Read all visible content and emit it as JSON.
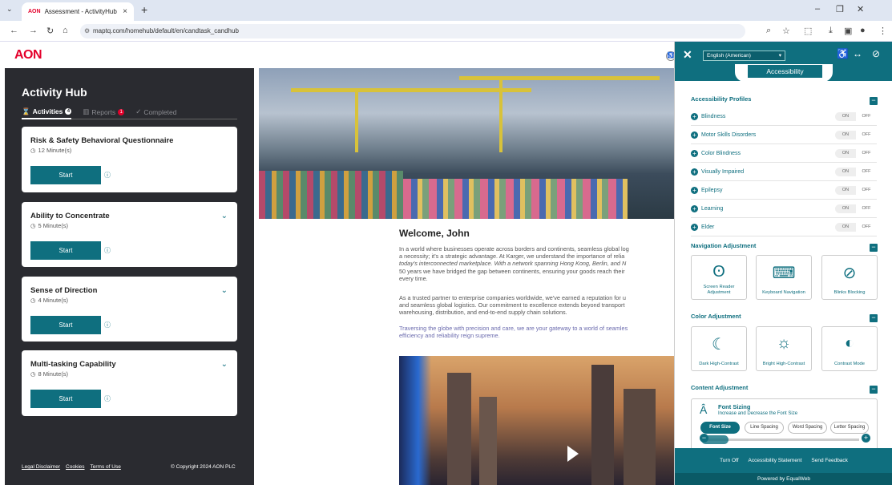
{
  "browser": {
    "tab_title": "Assessment - ActivityHub",
    "tab_favicon": "AON",
    "url": "maptq.com/homehub/default/en/candtask_candhub"
  },
  "brand": {
    "logo": "AON",
    "accent": "#e4002b",
    "teal": "#0f6f7f"
  },
  "sidebar": {
    "title": "Activity Hub",
    "tabs": [
      {
        "label": "Activities",
        "count": "4"
      },
      {
        "label": "Reports",
        "count": "1"
      },
      {
        "label": "Completed"
      }
    ],
    "cards": [
      {
        "title": "Risk & Safety Behavioral Questionnaire",
        "duration": "12 Minute(s)",
        "button": "Start"
      },
      {
        "title": "Ability to Concentrate",
        "duration": "5 Minute(s)",
        "button": "Start"
      },
      {
        "title": "Sense of Direction",
        "duration": "4 Minute(s)",
        "button": "Start"
      },
      {
        "title": "Multi-tasking Capability",
        "duration": "8 Minute(s)",
        "button": "Start"
      }
    ],
    "footer_links": [
      "Legal Disclaimer",
      "Cookies",
      "Terms of Use"
    ],
    "copyright": "© Copyright 2024 AON PLC"
  },
  "main": {
    "welcome": "Welcome, John",
    "paragraphs": [
      [
        "In a world where businesses operate across borders and continents, seamless global log",
        "a necessity; it's a strategic advantage. At Karger, we understand the importance of relia",
        "today's interconnected marketplace. With a network spanning Hong Kong, Berlin, and N",
        "50 years we have bridged the gap between continents, ensuring your goods reach their",
        "every time."
      ],
      [
        "As a trusted partner to enterprise companies worldwide, we've earned a reputation for u",
        "and seamless global logistics. Our commitment to excellence extends beyond transport",
        "warehousing, distribution, and end-to-end supply chain solutions."
      ],
      [
        "Traversing the globe with precision and care, we are your gateway to a world of seamles",
        "efficiency and reliability reign supreme."
      ]
    ]
  },
  "accessibility": {
    "language": "English (American)",
    "title": "Accessibility",
    "profiles_heading": "Accessibility Profiles",
    "on_label": "ON",
    "off_label": "OFF",
    "profiles": [
      "Blindness",
      "Motor Skills Disorders",
      "Color Blindness",
      "Visually Impaired",
      "Epilepsy",
      "Learning",
      "Elder"
    ],
    "nav_heading": "Navigation Adjustment",
    "nav_tiles": [
      "Screen Reader Adjustment",
      "Keyboard Navigation",
      "Blinks Blocking"
    ],
    "color_heading": "Color Adjustment",
    "color_tiles": [
      "Dark High-Contrast",
      "Bright High-Contrast",
      "Contrast Mode"
    ],
    "content_heading": "Content Adjustment",
    "font_sizing_title": "Font Sizing",
    "font_sizing_sub": "Increase and Decrease the Font Size",
    "font_options": [
      "Font Size",
      "Line Spacing",
      "Word Spacing",
      "Letter Spacing"
    ],
    "footer_links": [
      "Turn Off",
      "Accessibility Statement",
      "Send Feedback"
    ],
    "powered": "Powered by EqualWeb"
  }
}
